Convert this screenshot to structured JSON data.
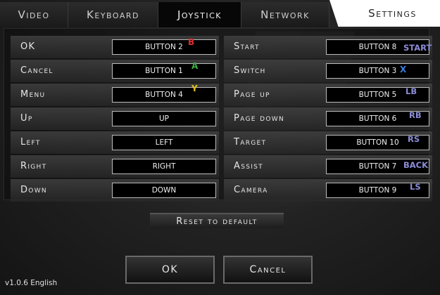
{
  "tabs": [
    {
      "label": "Video",
      "active": false
    },
    {
      "label": "Keyboard",
      "active": false
    },
    {
      "label": "Joystick",
      "active": true
    },
    {
      "label": "Network",
      "active": false
    },
    {
      "label": "Settings",
      "active": false
    }
  ],
  "left_bindings": [
    {
      "action": "OK",
      "binding": "BUTTON 2",
      "hint": "B",
      "hint_color": "#e03030"
    },
    {
      "action": "Cancel",
      "binding": "BUTTON 1",
      "hint": "A",
      "hint_color": "#3cb043"
    },
    {
      "action": "Menu",
      "binding": "BUTTON 4",
      "hint": "Y",
      "hint_color": "#e6c619"
    },
    {
      "action": "Up",
      "binding": "UP",
      "hint": "",
      "hint_color": ""
    },
    {
      "action": "Left",
      "binding": "LEFT",
      "hint": "",
      "hint_color": ""
    },
    {
      "action": "Right",
      "binding": "RIGHT",
      "hint": "",
      "hint_color": ""
    },
    {
      "action": "Down",
      "binding": "DOWN",
      "hint": "",
      "hint_color": ""
    }
  ],
  "right_bindings": [
    {
      "action": "Start",
      "binding": "BUTTON 8",
      "hint": "START",
      "hint_color": "#8c8cd8"
    },
    {
      "action": "Switch",
      "binding": "BUTTON 3",
      "hint": "X",
      "hint_color": "#3a7fe0"
    },
    {
      "action": "Page up",
      "binding": "BUTTON 5",
      "hint": "LB",
      "hint_color": "#8c8cd8"
    },
    {
      "action": "Page down",
      "binding": "BUTTON 6",
      "hint": "RB",
      "hint_color": "#8c8cd8"
    },
    {
      "action": "Target",
      "binding": "BUTTON 10",
      "hint": "RS",
      "hint_color": "#8c8cd8"
    },
    {
      "action": "Assist",
      "binding": "BUTTON 7",
      "hint": "BACK",
      "hint_color": "#8c8cd8"
    },
    {
      "action": "Camera",
      "binding": "BUTTON 9",
      "hint": "LS",
      "hint_color": "#8c8cd8"
    }
  ],
  "reset_label": "Reset to default",
  "ok_label": "OK",
  "cancel_label": "Cancel",
  "version": "v1.0.6 English"
}
